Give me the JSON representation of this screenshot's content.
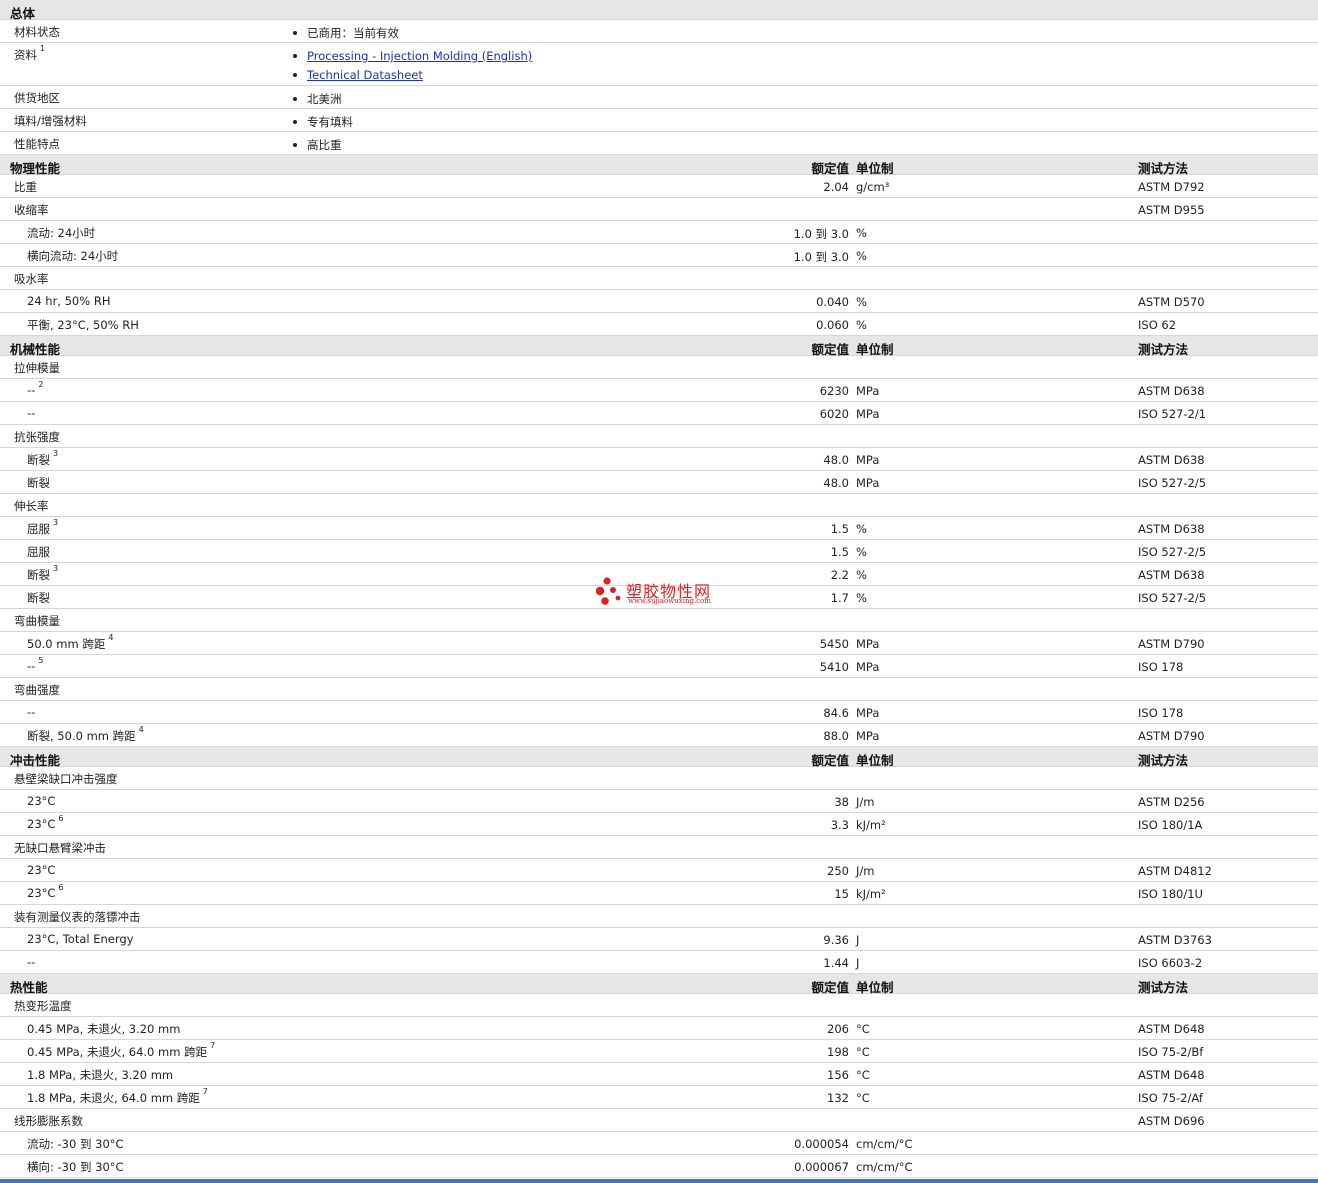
{
  "sections": [
    {
      "kind": "general",
      "title": "总体",
      "rows": [
        {
          "label": "材料状态",
          "items": [
            {
              "text": "已商用：当前有效"
            }
          ]
        },
        {
          "label": "资料",
          "note": "1",
          "items": [
            {
              "text": "Processing - Injection Molding (English)",
              "link": true
            },
            {
              "text": "Technical Datasheet",
              "link": true
            }
          ]
        },
        {
          "label": "供货地区",
          "items": [
            {
              "text": "北美洲"
            }
          ]
        },
        {
          "label": "填料/增强材料",
          "items": [
            {
              "text": "专有填料"
            }
          ]
        },
        {
          "label": "性能特点",
          "items": [
            {
              "text": "高比重"
            }
          ]
        }
      ]
    },
    {
      "kind": "data",
      "title": "物理性能",
      "headers": {
        "value": "额定值",
        "unit": "单位制",
        "method": "测试方法"
      },
      "rows": [
        {
          "label": "比重",
          "level": 0,
          "value": "2.04",
          "unit": "g/cm³",
          "method": "ASTM D792"
        },
        {
          "label": "收缩率",
          "level": 0,
          "method": "ASTM D955"
        },
        {
          "label": "流动: 24小时",
          "level": 1,
          "value": "1.0 到  3.0",
          "unit": "%"
        },
        {
          "label": "横向流动: 24小时",
          "level": 1,
          "value": "1.0 到  3.0",
          "unit": "%"
        },
        {
          "label": "吸水率",
          "level": 0
        },
        {
          "label": "24 hr, 50% RH",
          "level": 1,
          "value": "0.040",
          "unit": "%",
          "method": "ASTM D570"
        },
        {
          "label": "平衡, 23°C, 50% RH",
          "level": 1,
          "value": "0.060",
          "unit": "%",
          "method": "ISO 62"
        }
      ]
    },
    {
      "kind": "data",
      "title": "机械性能",
      "headers": {
        "value": "额定值",
        "unit": "单位制",
        "method": "测试方法"
      },
      "rows": [
        {
          "label": "拉伸模量",
          "level": 0
        },
        {
          "label": "--",
          "note": "2",
          "level": 1,
          "value": "6230",
          "unit": "MPa",
          "method": "ASTM D638"
        },
        {
          "label": "--",
          "level": 1,
          "value": "6020",
          "unit": "MPa",
          "method": "ISO 527-2/1"
        },
        {
          "label": "抗张强度",
          "level": 0
        },
        {
          "label": "断裂",
          "note": "3",
          "level": 1,
          "value": "48.0",
          "unit": "MPa",
          "method": "ASTM D638"
        },
        {
          "label": "断裂",
          "level": 1,
          "value": "48.0",
          "unit": "MPa",
          "method": "ISO 527-2/5"
        },
        {
          "label": "伸长率",
          "level": 0
        },
        {
          "label": "屈服",
          "note": "3",
          "level": 1,
          "value": "1.5",
          "unit": "%",
          "method": "ASTM D638"
        },
        {
          "label": "屈服",
          "level": 1,
          "value": "1.5",
          "unit": "%",
          "method": "ISO 527-2/5"
        },
        {
          "label": "断裂",
          "note": "3",
          "level": 1,
          "value": "2.2",
          "unit": "%",
          "method": "ASTM D638"
        },
        {
          "label": "断裂",
          "level": 1,
          "value": "1.7",
          "unit": "%",
          "method": "ISO 527-2/5"
        },
        {
          "label": "弯曲模量",
          "level": 0
        },
        {
          "label": "50.0 mm 跨距",
          "note": "4",
          "level": 1,
          "value": "5450",
          "unit": "MPa",
          "method": "ASTM D790"
        },
        {
          "label": "--",
          "note": "5",
          "level": 1,
          "value": "5410",
          "unit": "MPa",
          "method": "ISO 178"
        },
        {
          "label": "弯曲强度",
          "level": 0
        },
        {
          "label": "--",
          "level": 1,
          "value": "84.6",
          "unit": "MPa",
          "method": "ISO 178"
        },
        {
          "label": "断裂, 50.0 mm 跨距",
          "note": "4",
          "level": 1,
          "value": "88.0",
          "unit": "MPa",
          "method": "ASTM D790"
        }
      ]
    },
    {
      "kind": "data",
      "title": "冲击性能",
      "headers": {
        "value": "额定值",
        "unit": "单位制",
        "method": "测试方法"
      },
      "rows": [
        {
          "label": "悬壁梁缺口冲击强度",
          "level": 0
        },
        {
          "label": "23°C",
          "level": 1,
          "value": "38",
          "unit": "J/m",
          "method": "ASTM D256"
        },
        {
          "label": "23°C",
          "note": "6",
          "level": 1,
          "value": "3.3",
          "unit": "kJ/m²",
          "method": "ISO 180/1A"
        },
        {
          "label": "无缺口悬臂梁冲击",
          "level": 0
        },
        {
          "label": "23°C",
          "level": 1,
          "value": "250",
          "unit": "J/m",
          "method": "ASTM D4812"
        },
        {
          "label": "23°C",
          "note": "6",
          "level": 1,
          "value": "15",
          "unit": "kJ/m²",
          "method": "ISO 180/1U"
        },
        {
          "label": "装有测量仪表的落镖冲击",
          "level": 0
        },
        {
          "label": "23°C, Total Energy",
          "level": 1,
          "value": "9.36",
          "unit": "J",
          "method": "ASTM D3763"
        },
        {
          "label": "--",
          "level": 1,
          "value": "1.44",
          "unit": "J",
          "method": "ISO 6603-2"
        }
      ]
    },
    {
      "kind": "data",
      "title": "热性能",
      "headers": {
        "value": "额定值",
        "unit": "单位制",
        "method": "测试方法"
      },
      "rows": [
        {
          "label": "热变形温度",
          "level": 0
        },
        {
          "label": "0.45 MPa, 未退火, 3.20 mm",
          "level": 1,
          "value": "206",
          "unit": "°C",
          "method": "ASTM D648"
        },
        {
          "label": "0.45 MPa, 未退火, 64.0 mm 跨距",
          "note": "7",
          "level": 1,
          "value": "198",
          "unit": "°C",
          "method": "ISO 75-2/Bf"
        },
        {
          "label": "1.8 MPa, 未退火, 3.20 mm",
          "level": 1,
          "value": "156",
          "unit": "°C",
          "method": "ASTM D648"
        },
        {
          "label": "1.8 MPa, 未退火, 64.0 mm 跨距",
          "note": "7",
          "level": 1,
          "value": "132",
          "unit": "°C",
          "method": "ISO 75-2/Af"
        },
        {
          "label": "线形膨胀系数",
          "level": 0,
          "method": "ASTM D696"
        },
        {
          "label": "流动: -30 到  30°C",
          "level": 1,
          "value": "0.000054",
          "unit": "cm/cm/°C"
        },
        {
          "label": "横向: -30 到  30°C",
          "level": 1,
          "value": "0.000067",
          "unit": "cm/cm/°C"
        }
      ]
    }
  ],
  "watermark": {
    "title": "塑胶物性网",
    "url": "www.sujiaowuxing.com",
    "color": "#e02020"
  },
  "colors": {
    "section_bg": "#e6e6e6",
    "link": "#1a32b8",
    "border": "#d6d6d6",
    "bottom_bar": "#4a72b0"
  }
}
